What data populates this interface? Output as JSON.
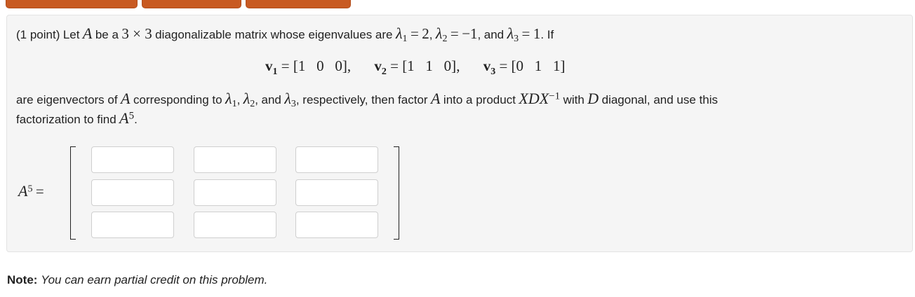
{
  "problem": {
    "points": "(1 point)",
    "intro_1": "Let",
    "A": "A",
    "intro_2": "be a",
    "three": "3",
    "times": "×",
    "intro_3": "diagonalizable matrix whose eigenvalues are",
    "lambda": "λ",
    "sub1": "1",
    "sub2": "2",
    "sub3": "3",
    "eq": "=",
    "val1": "2",
    "val2": "−1",
    "val3": "1",
    "comma": ",",
    "and": "and",
    "if": ". If",
    "v1_lhs": "v",
    "v1_vec": "[1   0   0]",
    "v2_vec": "[1   1   0]",
    "v3_vec": "[0   1   1]",
    "line3_a": "are eigenvectors of",
    "line3_b": "corresponding to",
    "line3_c": ", respectively, then factor",
    "line3_d": "into a product",
    "XDX": "XDX",
    "inv": "−1",
    "line3_e": "with",
    "D": "D",
    "line3_f": "diagonal, and use this",
    "line4": "factorization to find",
    "exp5": "5",
    "period": "."
  },
  "answer": {
    "label_A": "A",
    "label_exp": "5",
    "label_eq": "=",
    "cells": [
      "",
      "",
      "",
      "",
      "",
      "",
      "",
      "",
      ""
    ]
  },
  "note": {
    "label": "Note:",
    "text": "You can earn partial credit on this problem."
  },
  "colors": {
    "tab": "#c85a22",
    "panel": "#f5f5f5"
  }
}
